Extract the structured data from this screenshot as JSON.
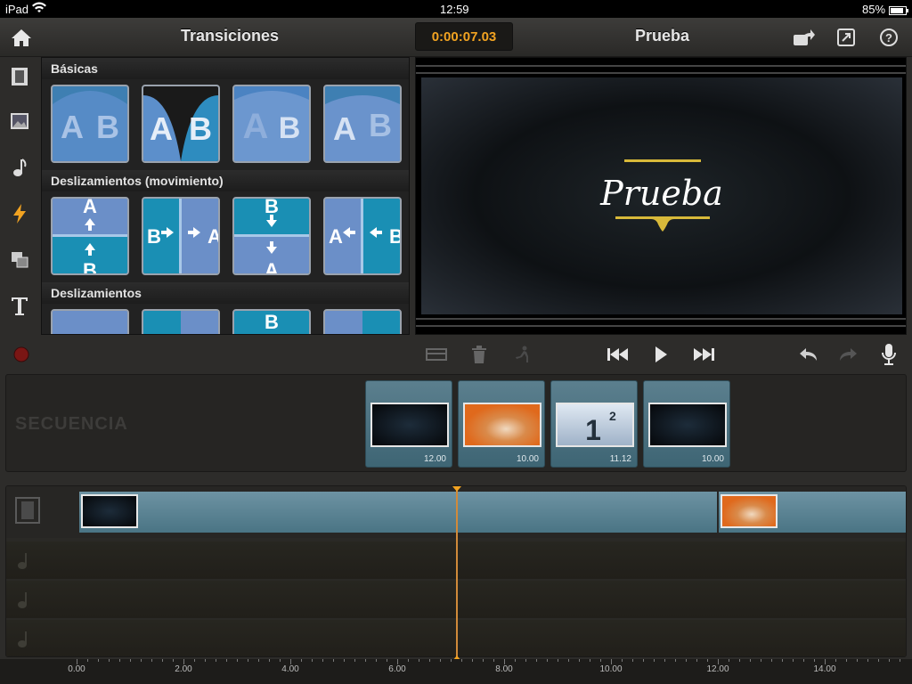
{
  "status": {
    "device": "iPad",
    "time": "12:59",
    "battery": "85%"
  },
  "topbar": {
    "left_title": "Transiciones",
    "timecode": "0:00:07.03",
    "project_title": "Prueba"
  },
  "icons": {
    "home": "home-icon",
    "share": "share-icon",
    "fullscreen": "fullscreen-icon",
    "help": "help-icon"
  },
  "sidebar": {
    "items": [
      "film-icon",
      "photo-icon",
      "music-icon",
      "transition-icon",
      "overlay-icon",
      "text-icon"
    ]
  },
  "transitions": {
    "sections": [
      {
        "label": "Básicas"
      },
      {
        "label": "Deslizamientos (movimiento)"
      },
      {
        "label": "Deslizamientos"
      }
    ]
  },
  "preview": {
    "title": "Prueba"
  },
  "sequence": {
    "label": "SECUENCIA",
    "clips": [
      {
        "duration": "12.00"
      },
      {
        "duration": "10.00"
      },
      {
        "duration": "11.12"
      },
      {
        "duration": "10.00"
      }
    ]
  },
  "ruler": {
    "labels": [
      "0.00",
      "2.00",
      "4.00",
      "6.00",
      "8.00",
      "10.00",
      "12.00",
      "14.00"
    ]
  },
  "colors": {
    "timecode": "#f2a321",
    "accent": "#f2a321",
    "playhead": "#d08a3a"
  }
}
